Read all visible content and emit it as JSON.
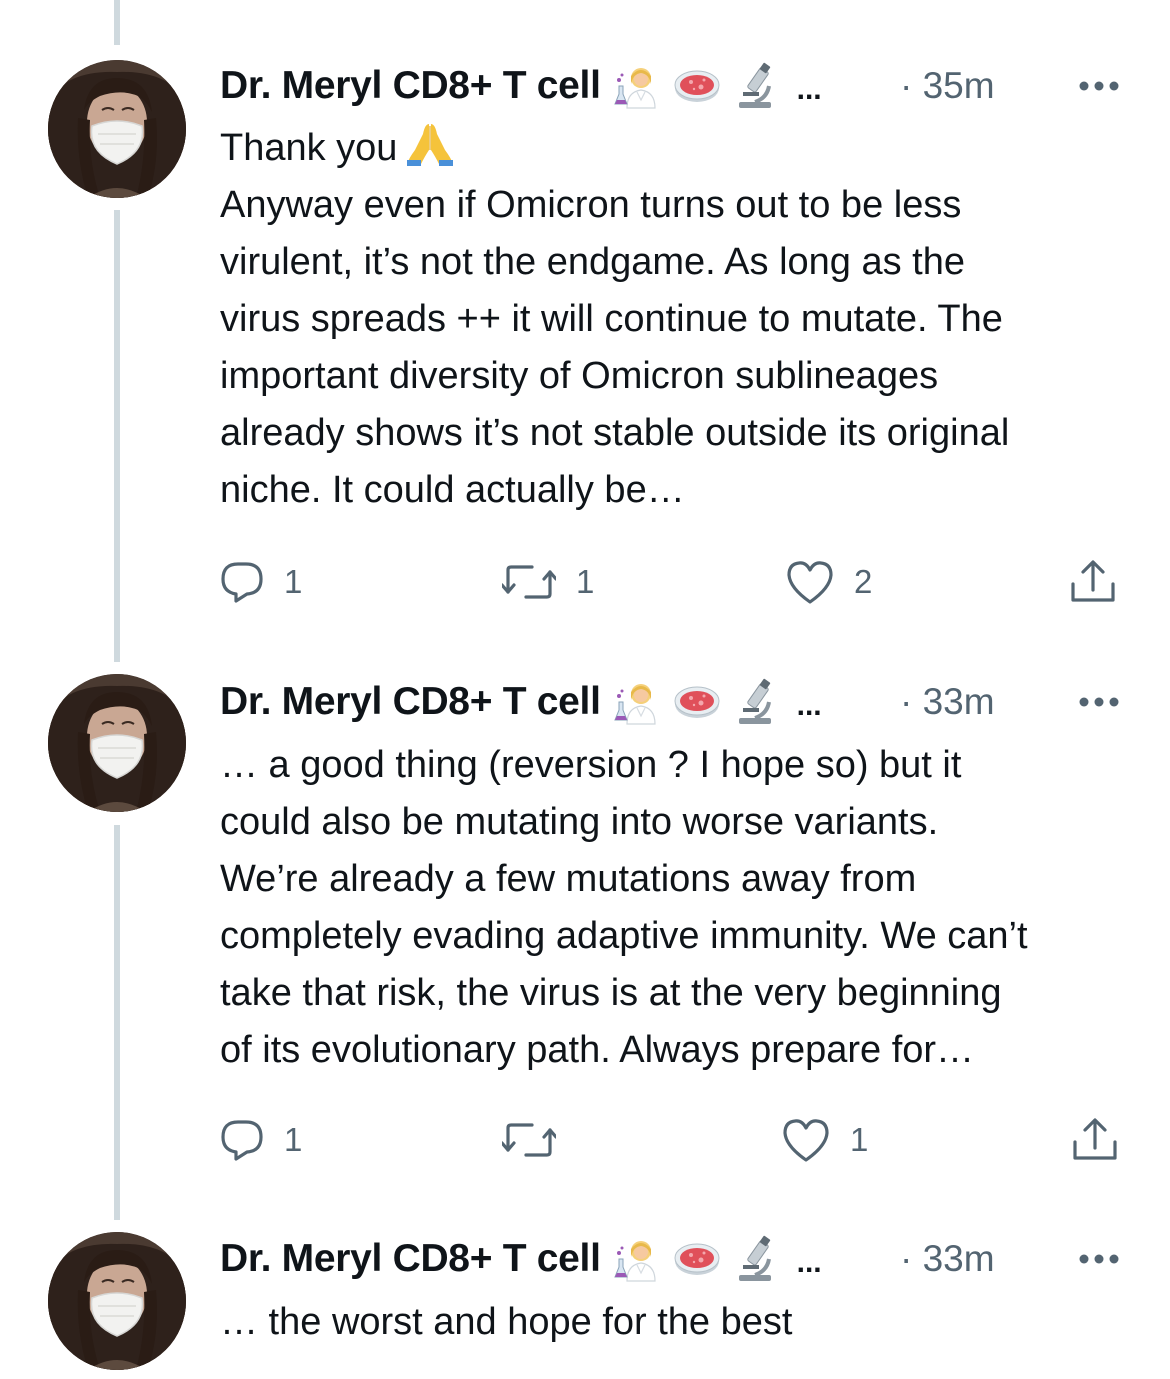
{
  "tweets": [
    {
      "author": "Dr. Meryl CD8+ T cell",
      "name_emojis": [
        "scientist-emoji",
        "petri-dish-emoji",
        "microscope-emoji"
      ],
      "name_truncation": "...",
      "time": "· 35m",
      "body_lines": [
        "Thank you",
        "Anyway even if Omicron turns out to be less",
        "virulent, it’s not the endgame. As long as the",
        "virus spreads ++ it will continue to mutate. The",
        "important diversity of Omicron sublineages",
        "already shows it’s not stable outside its original",
        "niche. It could actually be…"
      ],
      "body_emoji": "folded-hands-emoji",
      "replies": "1",
      "retweets": "1",
      "likes": "2"
    },
    {
      "author": "Dr. Meryl CD8+ T cell",
      "name_emojis": [
        "scientist-emoji",
        "petri-dish-emoji",
        "microscope-emoji"
      ],
      "name_truncation": "...",
      "time": "· 33m",
      "body_lines": [
        "… a good thing (reversion ? I hope so) but it",
        "could also be mutating into worse variants.",
        "We’re already a few mutations away from",
        "completely evading adaptive immunity. We can’t",
        "take that risk, the virus is at the very beginning",
        "of its evolutionary path. Always prepare for…"
      ],
      "replies": "1",
      "retweets": "",
      "likes": "1"
    },
    {
      "author": "Dr. Meryl CD8+ T cell",
      "name_emojis": [
        "scientist-emoji",
        "petri-dish-emoji",
        "microscope-emoji"
      ],
      "name_truncation": "...",
      "time": "· 33m",
      "body_lines": [
        "… the worst and hope for the best"
      ]
    }
  ],
  "colors": {
    "text": "#0f1419",
    "secondary": "#536471",
    "thread_line": "#cfd9de"
  }
}
